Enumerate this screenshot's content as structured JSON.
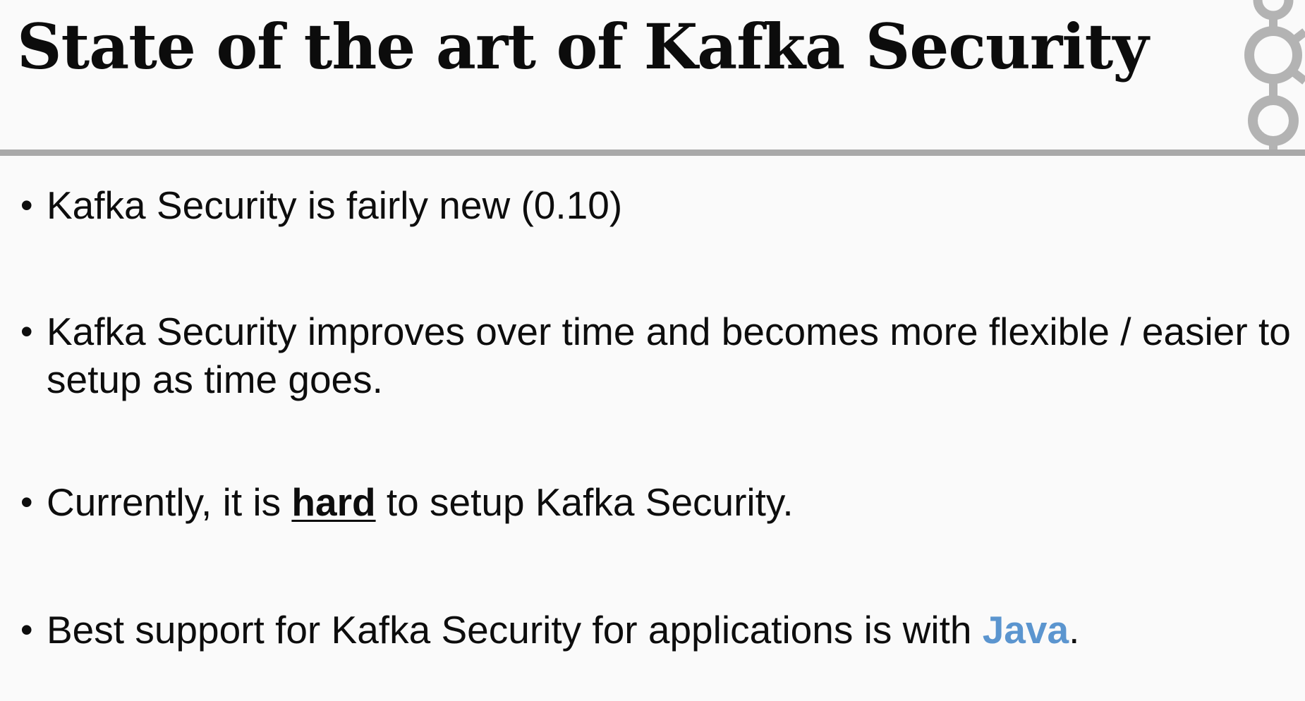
{
  "slide": {
    "title": "State of the art of Kafka Security",
    "bullet_glyph": "•",
    "bullets": [
      {
        "text": "Kafka Security is fairly new (0.10)"
      },
      {
        "text": "Kafka Security improves over time and becomes more flexible / easier to setup as time goes."
      },
      {
        "before": "Currently, it is ",
        "emphasis": "hard",
        "after": " to setup Kafka Security."
      },
      {
        "before": "Best support for Kafka Security for applications is with ",
        "emphasis": "Java",
        "after": "."
      }
    ]
  },
  "logo": {
    "icon": "kafka-logo-icon",
    "color": "#b3b3b3"
  },
  "colors": {
    "background": "#fafafa",
    "text": "#0d0d0d",
    "divider": "#a9a9a9",
    "java_accent": "#5b95cf"
  }
}
